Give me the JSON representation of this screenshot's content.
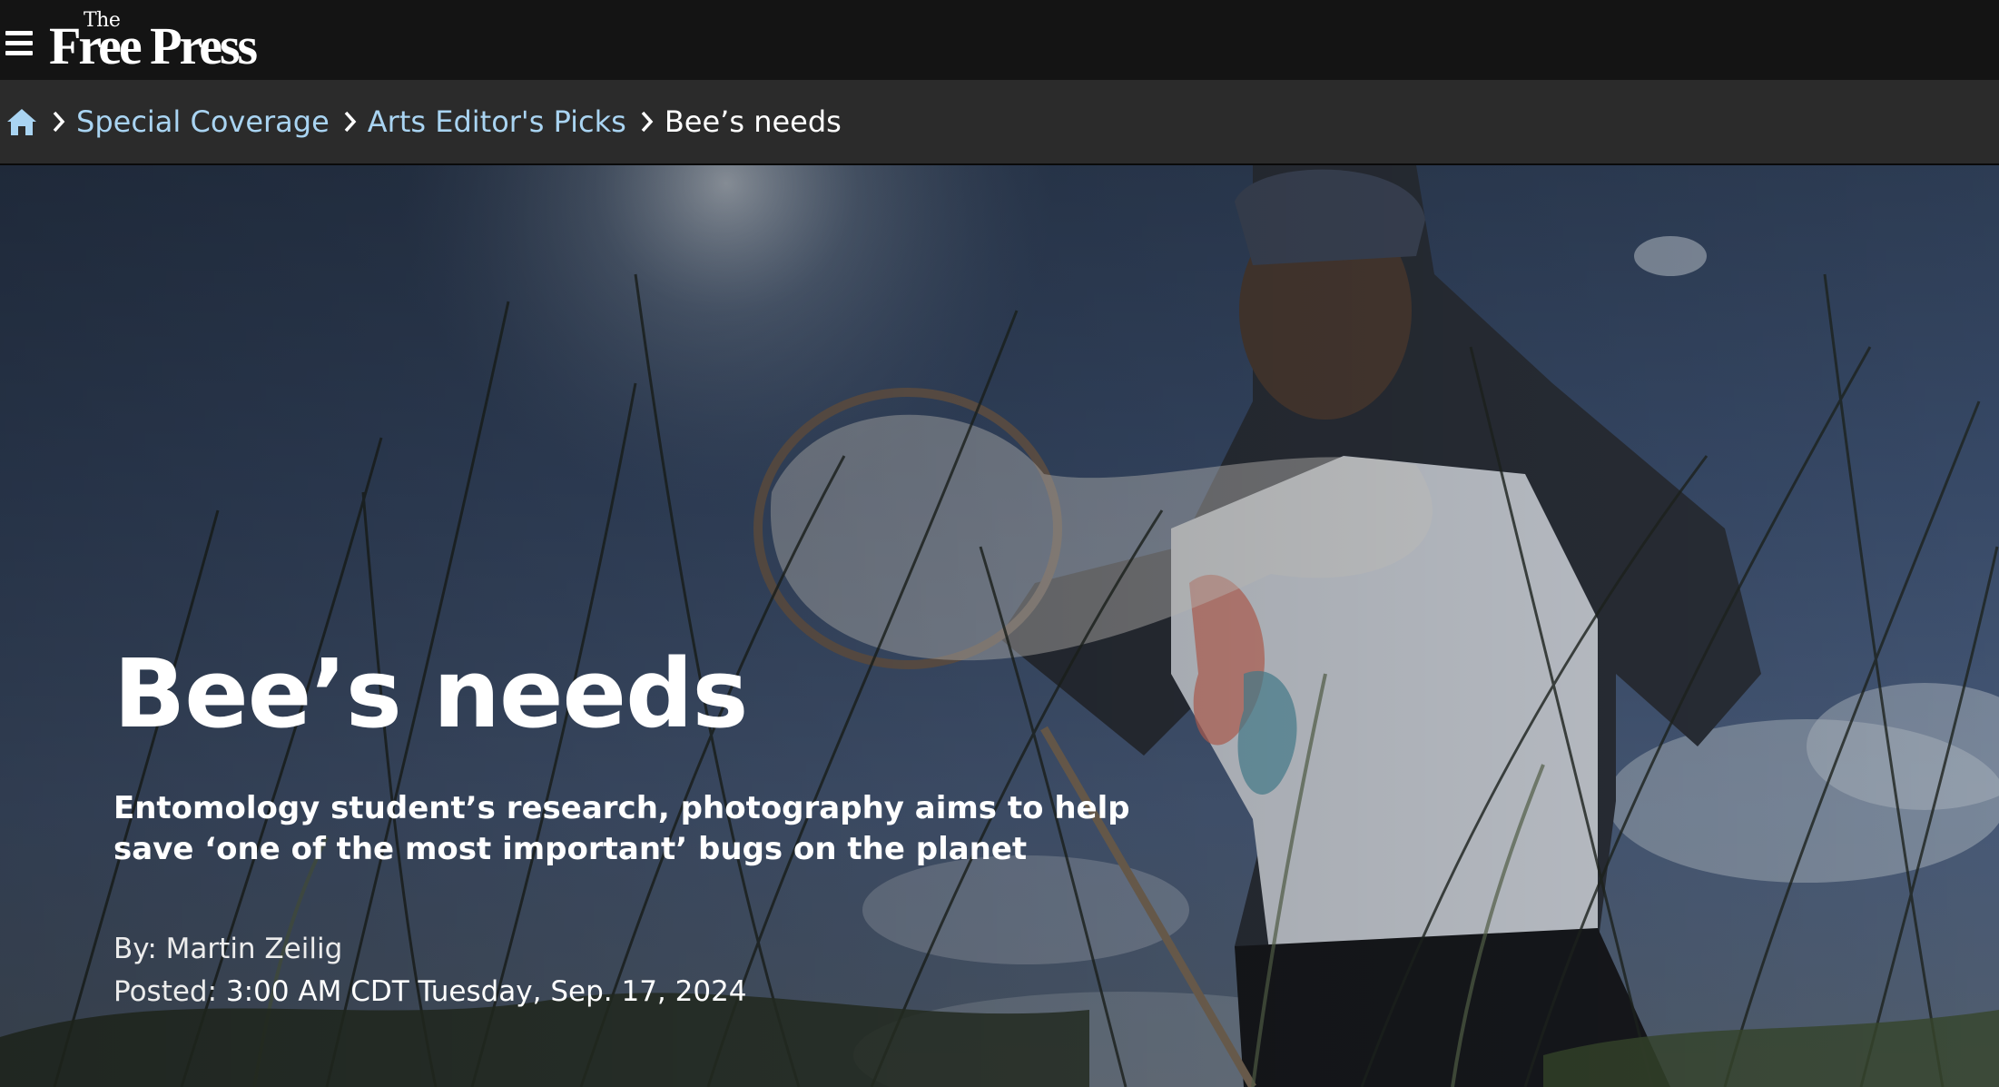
{
  "header": {
    "menu_icon": "hamburger-menu-icon",
    "logo_prefix": "The",
    "logo_name": "Free Press"
  },
  "breadcrumb": {
    "home_icon": "home-icon",
    "items": [
      "Special Coverage",
      "Arts Editor's Picks"
    ],
    "current": "Bee’s needs"
  },
  "article": {
    "headline": "Bee’s needs",
    "subheadline": "Entomology student’s research, photography aims to help save ‘one of the most important’ bugs on the planet",
    "byline_label": "By:",
    "author": "Martin Zeilig",
    "posted_label": "Posted:",
    "posted_time": "3:00 AM CDT Tuesday, Sep. 17, 2024"
  },
  "colors": {
    "header_bg": "#141414",
    "breadcrumb_bg": "#2b2b2b",
    "link": "#a9d4f2"
  }
}
